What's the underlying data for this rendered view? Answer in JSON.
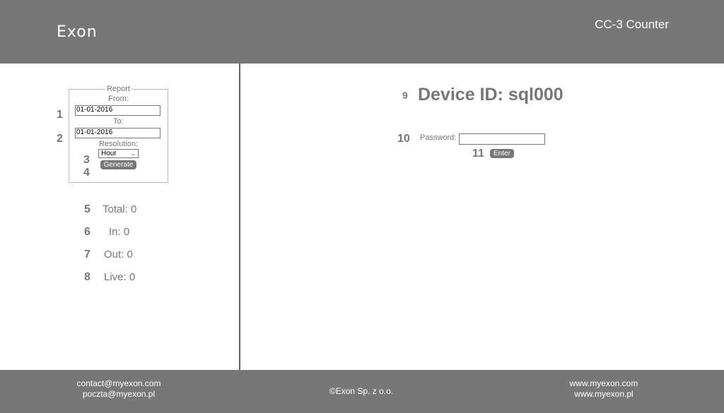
{
  "header": {
    "logo": "Exon",
    "title": "CC-3 Counter"
  },
  "report": {
    "legend": "Report",
    "from_label": "From:",
    "from_value": "01-01-2016",
    "to_label": "To:",
    "to_value": "01-01-2016",
    "resolution_label": "Resolution:",
    "resolution_value": "Hour",
    "generate_label": "Generate"
  },
  "markers": [
    "1",
    "2",
    "3",
    "4",
    "5",
    "6",
    "7",
    "8",
    "9",
    "10",
    "11"
  ],
  "stats": {
    "total": "Total: 0",
    "in": "In: 0",
    "out": "Out: 0",
    "live": "Live: 0"
  },
  "device": {
    "title": "Device ID: sql000",
    "password_label": "Password:",
    "password_value": "",
    "enter_label": "Enter"
  },
  "footer": {
    "email1": "contact@myexon.com",
    "email2": "poczta@myexon.pl",
    "copyright": "©Exon Sp. z o.o.",
    "web1": "www.myexon.com",
    "web2": "www.myexon.pl"
  }
}
